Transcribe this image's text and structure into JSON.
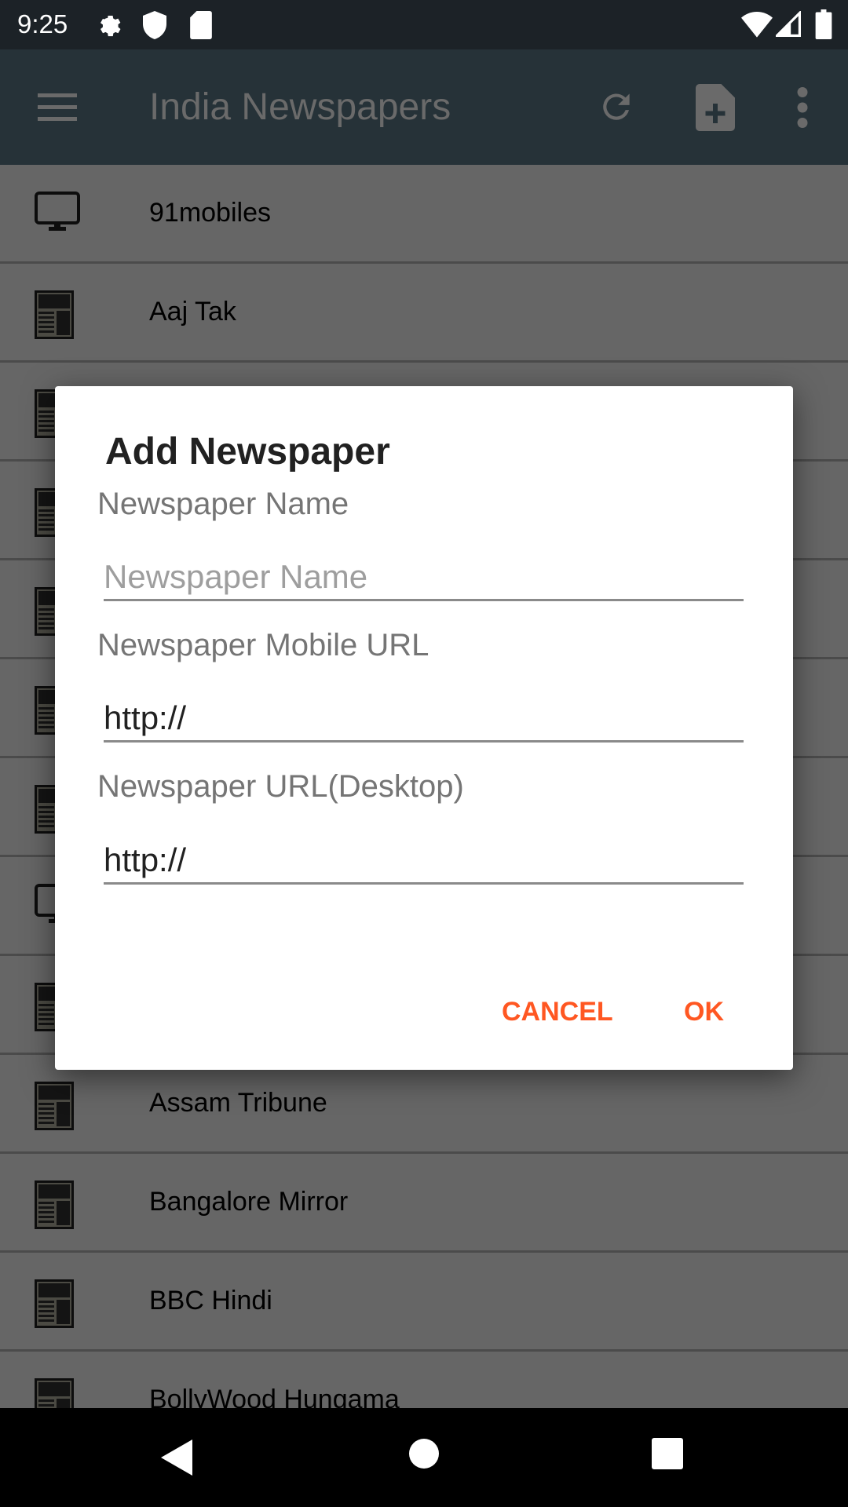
{
  "status_bar": {
    "time": "9:25",
    "icons": [
      "settings-icon",
      "shield-icon",
      "sd-card-icon",
      "wifi-icon",
      "signal-icon",
      "battery-icon"
    ]
  },
  "toolbar": {
    "title": "India Newspapers",
    "icons": [
      "menu-icon",
      "refresh-icon",
      "add-document-icon",
      "more-vert-icon"
    ]
  },
  "list": {
    "items": [
      {
        "name": "91mobiles",
        "icon": "monitor"
      },
      {
        "name": "Aaj Tak",
        "icon": "newspaper"
      },
      {
        "name": "",
        "icon": "newspaper"
      },
      {
        "name": "",
        "icon": "newspaper"
      },
      {
        "name": "",
        "icon": "newspaper"
      },
      {
        "name": "",
        "icon": "newspaper"
      },
      {
        "name": "",
        "icon": "newspaper"
      },
      {
        "name": "",
        "icon": "monitor"
      },
      {
        "name": "",
        "icon": "newspaper"
      },
      {
        "name": "Assam Tribune",
        "icon": "newspaper"
      },
      {
        "name": "Bangalore Mirror",
        "icon": "newspaper"
      },
      {
        "name": "BBC Hindi",
        "icon": "newspaper"
      },
      {
        "name": "BollyWood Hungama",
        "icon": "newspaper"
      }
    ]
  },
  "dialog": {
    "title": "Add Newspaper",
    "name_label": "Newspaper Name",
    "name_value": "",
    "name_placeholder": "Newspaper Name",
    "mobile_label": "Newspaper Mobile URL",
    "mobile_value": "http://",
    "desktop_label": "Newspaper URL(Desktop)",
    "desktop_value": "http://",
    "cancel": "CANCEL",
    "ok": "OK"
  },
  "colors": {
    "accent": "#ff5722",
    "toolbar": "#607d8b",
    "status": "#455a64"
  }
}
